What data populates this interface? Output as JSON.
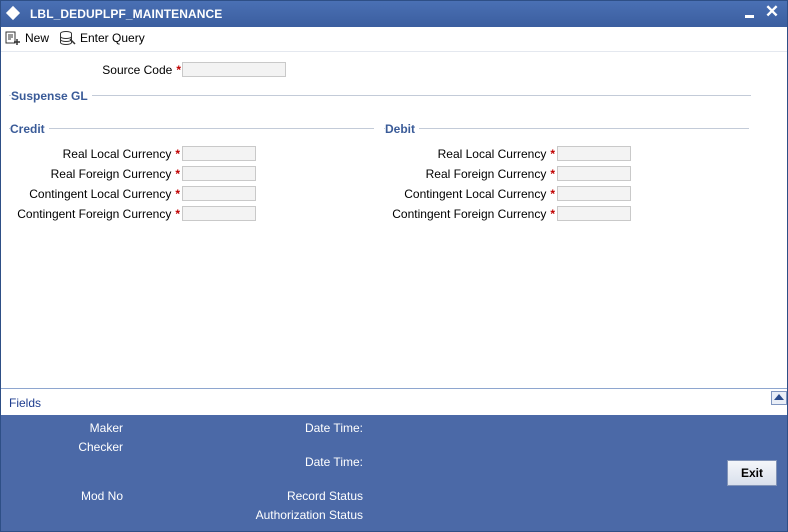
{
  "window": {
    "title": "LBL_DEDUPLPF_MAINTENANCE"
  },
  "toolbar": {
    "new_label": "New",
    "enter_query_label": "Enter Query"
  },
  "form": {
    "source_code_label": "Source Code",
    "required_marker": "*",
    "suspense_gl_title": "Suspense GL",
    "credit": {
      "title": "Credit",
      "real_local_label": "Real Local Currency",
      "real_foreign_label": "Real Foreign Currency",
      "contingent_local_label": "Contingent Local Currency",
      "contingent_foreign_label": "Contingent Foreign Currency"
    },
    "debit": {
      "title": "Debit",
      "real_local_label": "Real Local Currency",
      "real_foreign_label": "Real Foreign Currency",
      "contingent_local_label": "Contingent Local Currency",
      "contingent_foreign_label": "Contingent Foreign Currency"
    }
  },
  "fields_bar": {
    "label": "Fields"
  },
  "audit": {
    "maker_label": "Maker",
    "checker_label": "Checker",
    "mod_no_label": "Mod No",
    "date_time_label": "Date Time:",
    "record_status_label": "Record Status",
    "authorization_status_label": "Authorization Status",
    "exit_label": "Exit"
  },
  "colors": {
    "titlebar": "#3b5e9f",
    "audit_panel": "#4b69a7",
    "required": "#c00000",
    "section_title": "#3a5b98"
  }
}
